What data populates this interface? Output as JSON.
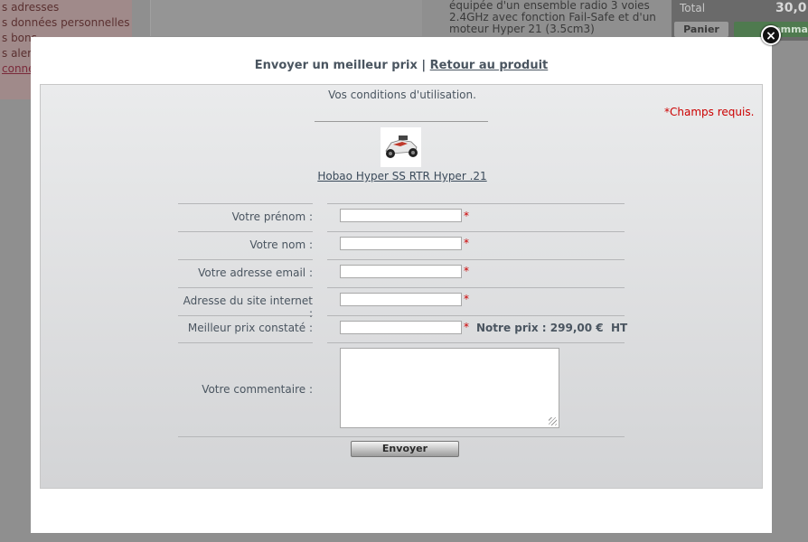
{
  "background": {
    "account_links": [
      "s adresses",
      "s données personnelles",
      "s bons",
      "s alertes",
      "conne"
    ],
    "product_description": "équipée d'un ensemble radio 3 voies 2.4GHz avec fonction Fail-Safe et d'un moteur Hyper 21 (3.5cm3)",
    "cart": {
      "total_label": "Total",
      "total_value": "30,0",
      "panier_label": "Panier",
      "commander_label": "Commander"
    }
  },
  "modal": {
    "title": "Envoyer un meilleur prix",
    "title_separator": "|",
    "back_link": "Retour au produit",
    "close_label": "×",
    "conditions_text": "Vos conditions d'utilisation.",
    "required_note": "*Champs requis.",
    "product": {
      "name": "Hobao Hyper SS RTR Hyper .21",
      "image": "rc-buggy-image"
    },
    "fields": [
      {
        "label": "Votre prénom :",
        "value": "",
        "required": "*"
      },
      {
        "label": "Votre nom :",
        "value": "",
        "required": "*"
      },
      {
        "label": "Votre adresse email :",
        "value": "",
        "required": "*"
      },
      {
        "label": "Adresse du site internet :",
        "value": "",
        "required": "*"
      },
      {
        "label": "Meilleur prix constaté :",
        "value": "",
        "required": "*"
      }
    ],
    "price_note": "Notre prix : 299,00 €  HT",
    "comment": {
      "label": "Votre commentaire :",
      "value": ""
    },
    "submit_label": "Envoyer"
  },
  "colors": {
    "accent_red": "#cc0000",
    "text": "#4a5560",
    "overlay": "#8f8f8f"
  }
}
